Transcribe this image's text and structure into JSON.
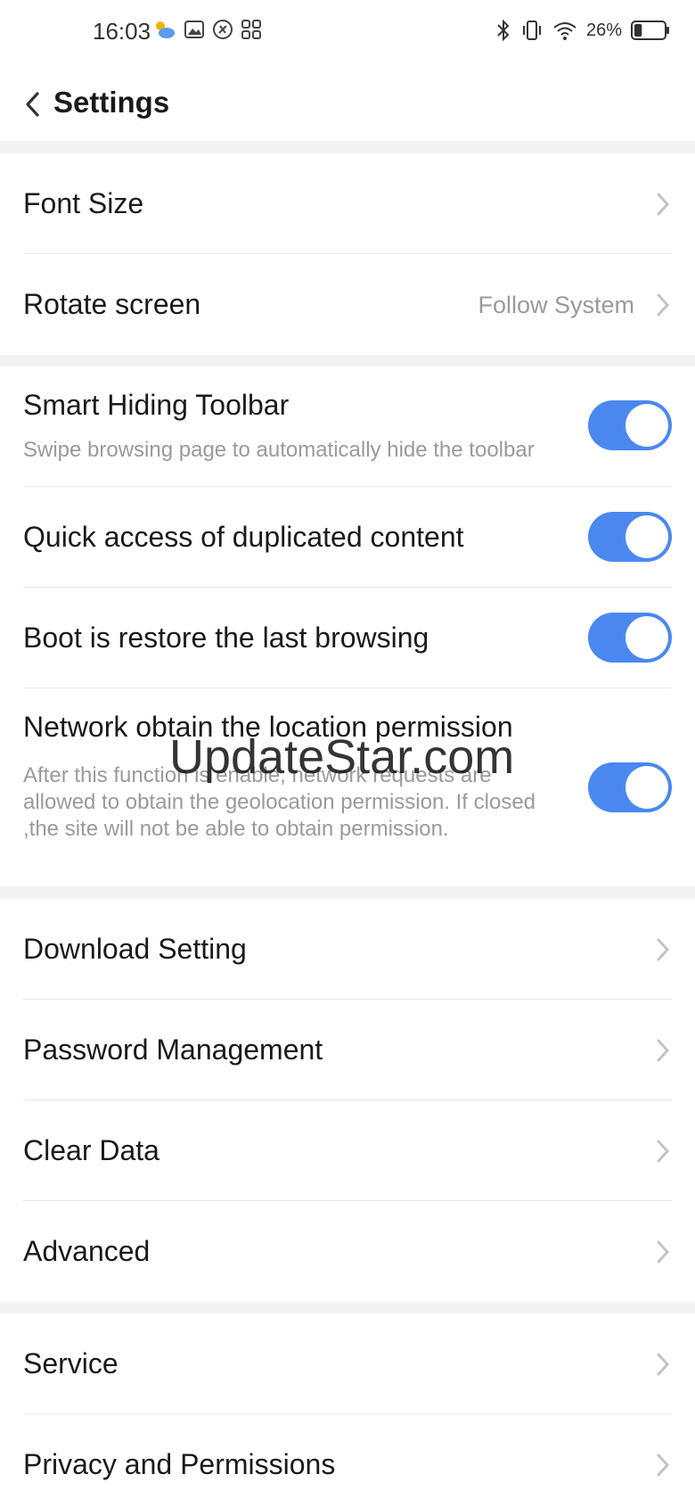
{
  "status_bar": {
    "time": "16:03",
    "battery_percent": "26%",
    "icons_left": [
      "weather-icon",
      "gallery-icon",
      "app-icon",
      "grid-icon"
    ],
    "icons_right": [
      "bluetooth-icon",
      "vibrate-icon",
      "wifi-icon",
      "battery-icon"
    ],
    "battery_level": 0.26
  },
  "header": {
    "title": "Settings"
  },
  "colors": {
    "toggle_on": "#4a88f0",
    "section_gap": "#f3f3f3",
    "secondary_text": "#9a9a9a"
  },
  "settings": {
    "font_size": {
      "label": "Font Size"
    },
    "rotate_screen": {
      "label": "Rotate screen",
      "value": "Follow System"
    },
    "smart_hiding_toolbar": {
      "label": "Smart Hiding Toolbar",
      "description": "Swipe browsing page to automatically hide the toolbar",
      "enabled": true
    },
    "quick_access": {
      "label": "Quick access of duplicated content",
      "enabled": true
    },
    "boot_restore": {
      "label": "Boot is restore the last browsing",
      "enabled": true
    },
    "network_location": {
      "label": "Network obtain the location permission",
      "description": "After this function is enable, network requests are allowed to obtain the geolocation permission. If closed ,the site will not be able to obtain permission.",
      "enabled": true
    },
    "download_setting": {
      "label": "Download Setting"
    },
    "password_management": {
      "label": "Password Management"
    },
    "clear_data": {
      "label": "Clear Data"
    },
    "advanced": {
      "label": "Advanced"
    },
    "service": {
      "label": "Service"
    },
    "privacy_permissions": {
      "label": "Privacy and Permissions"
    }
  },
  "watermark": "UpdateStar.com"
}
